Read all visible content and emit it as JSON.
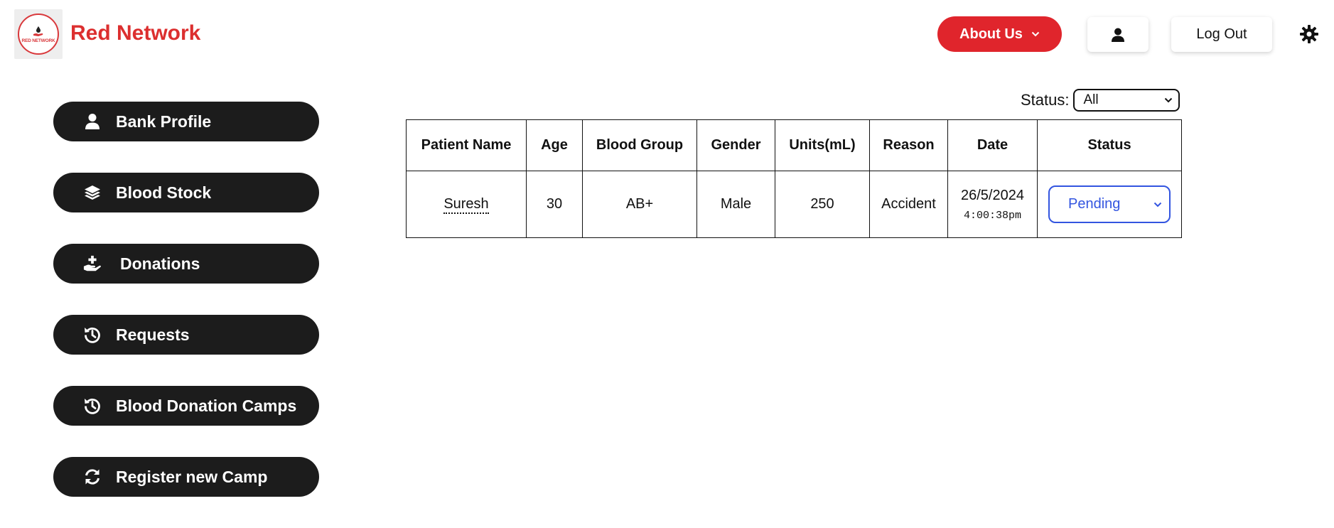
{
  "brand": {
    "logo_text": "RED NETWORK",
    "name": "Red Network",
    "color": "#dc2f2f"
  },
  "header": {
    "about_label": "About Us",
    "logout_label": "Log Out",
    "accent": "#e0252c"
  },
  "sidebar": {
    "items": [
      {
        "label": "Bank Profile",
        "icon": "user-icon"
      },
      {
        "label": "Blood Stock",
        "icon": "layers-icon"
      },
      {
        "label": "Donations",
        "icon": "hand-plus-icon"
      },
      {
        "label": "Requests",
        "icon": "history-icon"
      },
      {
        "label": "Blood Donation Camps",
        "icon": "history-icon"
      },
      {
        "label": "Register new Camp",
        "icon": "refresh-icon"
      }
    ]
  },
  "filter": {
    "label": "Status:",
    "value": "All"
  },
  "table": {
    "headers": [
      "Patient Name",
      "Age",
      "Blood Group",
      "Gender",
      "Units(mL)",
      "Reason",
      "Date",
      "Status"
    ],
    "rows": [
      {
        "patient": "Suresh",
        "age": "30",
        "blood_group": "AB+",
        "gender": "Male",
        "units": "250",
        "reason": "Accident",
        "date": "26/5/2024",
        "time": "4:00:38pm",
        "status": "Pending"
      }
    ]
  }
}
